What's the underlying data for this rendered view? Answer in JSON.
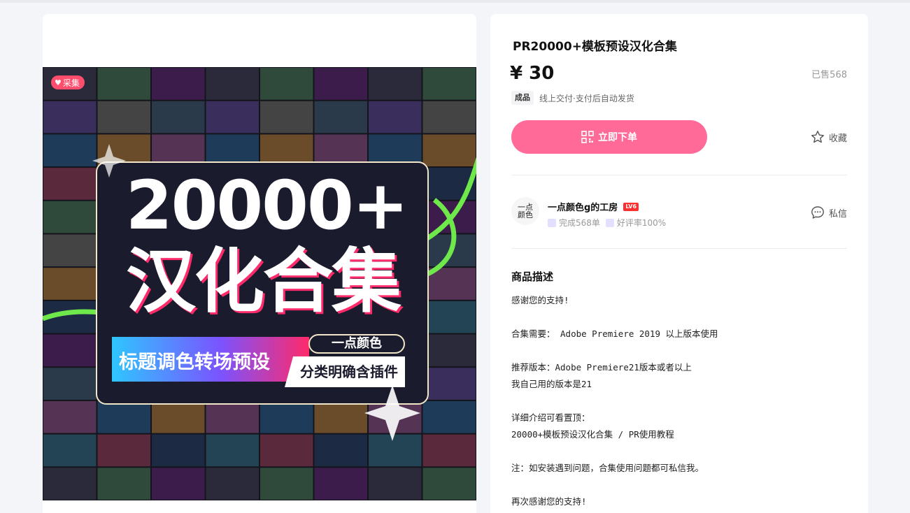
{
  "product": {
    "badge": "采集",
    "cover": {
      "big_number": "20000+",
      "big_title": "汉化合集",
      "banner_left": "标题调色转场预设",
      "banner_brand": "一点颜色",
      "banner_right": "分类明确含插件"
    },
    "title": "PR20000+模板预设汉化合集",
    "price": "¥ 30",
    "sold": "已售568",
    "tag": "成品",
    "delivery": "线上交付·支付后自动发货",
    "buy_label": "立即下单",
    "fav_label": "收藏",
    "colors": {
      "accent": "#ff6a99",
      "badge": "#ff4d6d",
      "level": "#ff2e2e"
    }
  },
  "seller": {
    "avatar_text": "一点颜色",
    "name": "一点颜色g的工房",
    "level": "LV6",
    "completed": "完成568单",
    "rating": "好评率100%",
    "message_label": "私信"
  },
  "description": {
    "heading": "商品描述",
    "lines": [
      "感谢您的支持!",
      "",
      "合集需要： Adobe Premiere 2019 以上版本使用",
      "",
      "推荐版本：Adobe Premiere21版本或者以上",
      "我自己用的版本是21",
      "",
      "详细介绍可看置顶：",
      "20000+模板预设汉化合集 / PR使用教程",
      "",
      "注：如安装遇到问题，合集使用问题都可私信我。",
      "",
      "再次感谢您的支持!"
    ]
  },
  "icons": [
    "heart-icon",
    "qr-code-icon",
    "star-icon",
    "chat-icon",
    "badge-icon"
  ]
}
